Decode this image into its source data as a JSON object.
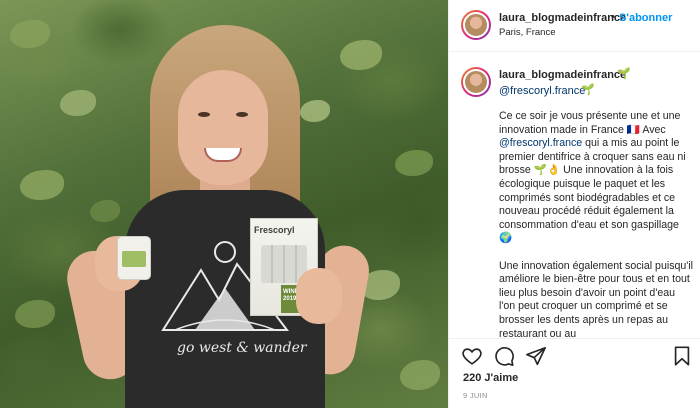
{
  "post": {
    "username": "laura_blogmadeinfrance",
    "separator": "•",
    "follow_label": "S'abonner",
    "location": "Paris, France",
    "caption": {
      "username": "laura_blogmadeinfrance",
      "brand_mention": "@frescoryl.france",
      "paragraph1_start": "Ce ce soir je vous présente une et une innovation made in France 🇫🇷 Avec ",
      "paragraph1_mention": "@frescoryl.france",
      "paragraph1_rest": " qui a mis au point le premier dentifrice à croquer sans eau ni brosse ",
      "paragraph1_emoji": "🌱👌",
      "paragraph1_end": " Une innovation à la fois écologique puisque le paquet et les comprimés sont biodégradables et ce nouveau procédé réduit également la consommation d'eau et son gaspillage ",
      "paragraph1_globe": "🌍",
      "paragraph2": "Une innovation également social puisqu'il améliore le bien-être pour tous et en tout lieu plus besoin d'avoir un point d'eau l'on peut croquer un comprimé et se brosser les dents après un repas au restaurant ou au"
    },
    "likes": "220 J'aime",
    "date": "9 JUIN"
  },
  "photo": {
    "shirt_text": "go west & wander",
    "flyer_brand": "Frescoryl",
    "flyer_award": "WINNER 2019"
  },
  "icons": {
    "like": "heart-icon",
    "comment": "comment-icon",
    "share": "share-icon",
    "save": "bookmark-icon",
    "sprout": "seedling-icon"
  },
  "colors": {
    "follow": "#0095f6",
    "mention": "#00376b",
    "text": "#262626",
    "muted": "#8e8e8e"
  }
}
